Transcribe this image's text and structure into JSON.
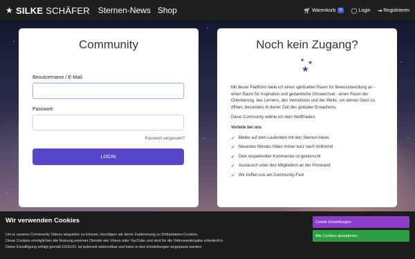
{
  "navbar": {
    "brand_bold": "SILKE",
    "brand_rest": "SCHÄFER",
    "links": [
      "Sternen-News",
      "Shop"
    ],
    "cart_label": "Warenkorb",
    "cart_count": "0",
    "login_label": "Login",
    "register_label": "Registrieren"
  },
  "login_card": {
    "title": "Community",
    "username_label": "Benutzername / E-Mail:",
    "username_value": "",
    "password_label": "Passwort:",
    "password_value": "",
    "forgot_label": "Passwort vergessen?",
    "login_button": "LOGIN"
  },
  "info_card": {
    "title": "Noch kein Zugang?",
    "paragraph1": "Mit dieser Plattform biete ich einen spirituellen Raum für Bewusstwerdung an - einen Raum für Inspiration und gedankliche Ortswechsel - einen Raum der Orientierung, des Lernens, des Vernetzens und der Weite, um deinen Geist zu öffnen, besonders in dieser Zeit des globalen Erwachens.",
    "paragraph2": "Diese Community widme ich dem Weltfrieden.",
    "advantages_title": "Vorteile bei uns",
    "advantages": [
      "Bleibe auf dem Laufenden mit den Sternen-News",
      "Neuestes Monats-Video immer kurz nach Vollmond",
      "Dein respektvoller Kommentar ist gewünscht",
      "Austausch unter den Mitgliedern an der Pinnwand",
      "Wir treffen uns am Community-Fest"
    ]
  },
  "cookie_banner": {
    "title": "Wir verwenden Cookies",
    "line1": "Um in unserer Community Videos abspielen zu können, benötigen wir deine Zustimmung zu Drittanbieter-Cookies.",
    "line2": "Diese Cookies ermöglichen die Nutzung externer Dienste wie Vimeo oder YouTube und sind für die Videowiedergabe erforderlich.",
    "line3": "Deine Einwilligung erfolgt gemäß DSGVO, ist jederzeit widerrufbar und kann in den Einstellungen angepasst werden.",
    "settings_button": "Cookie Einstellungen",
    "accept_button": "Alle Cookies akzeptieren"
  },
  "colors": {
    "accent": "#5645c8",
    "settings": "#8a3ec9",
    "accept": "#2e9e44"
  }
}
